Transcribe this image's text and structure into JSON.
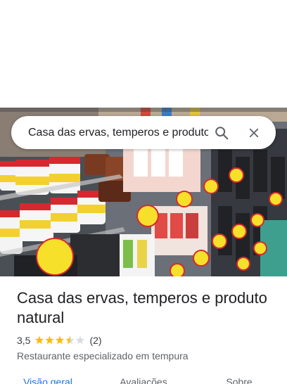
{
  "search": {
    "value": "Casa das ervas, temperos e produto",
    "search_icon": "search-icon",
    "close_icon": "close-icon"
  },
  "hero_photo": {
    "description_icon": "store-shelf-photo"
  },
  "place": {
    "title": "Casa das ervas, temperos e produto natural",
    "rating": "3,5",
    "rating_value": 3.5,
    "stars_max": 5,
    "review_count": "(2)",
    "category": "Restaurante especializado em tempura"
  },
  "tabs": [
    {
      "label": "Visão geral",
      "active": true
    },
    {
      "label": "Avaliações",
      "active": false
    },
    {
      "label": "Sobre",
      "active": false
    }
  ],
  "colors": {
    "accent": "#1a73e8",
    "star": "#fbbc04",
    "star_empty": "#dadce0",
    "title": "#202124",
    "secondary": "#5f6368"
  }
}
